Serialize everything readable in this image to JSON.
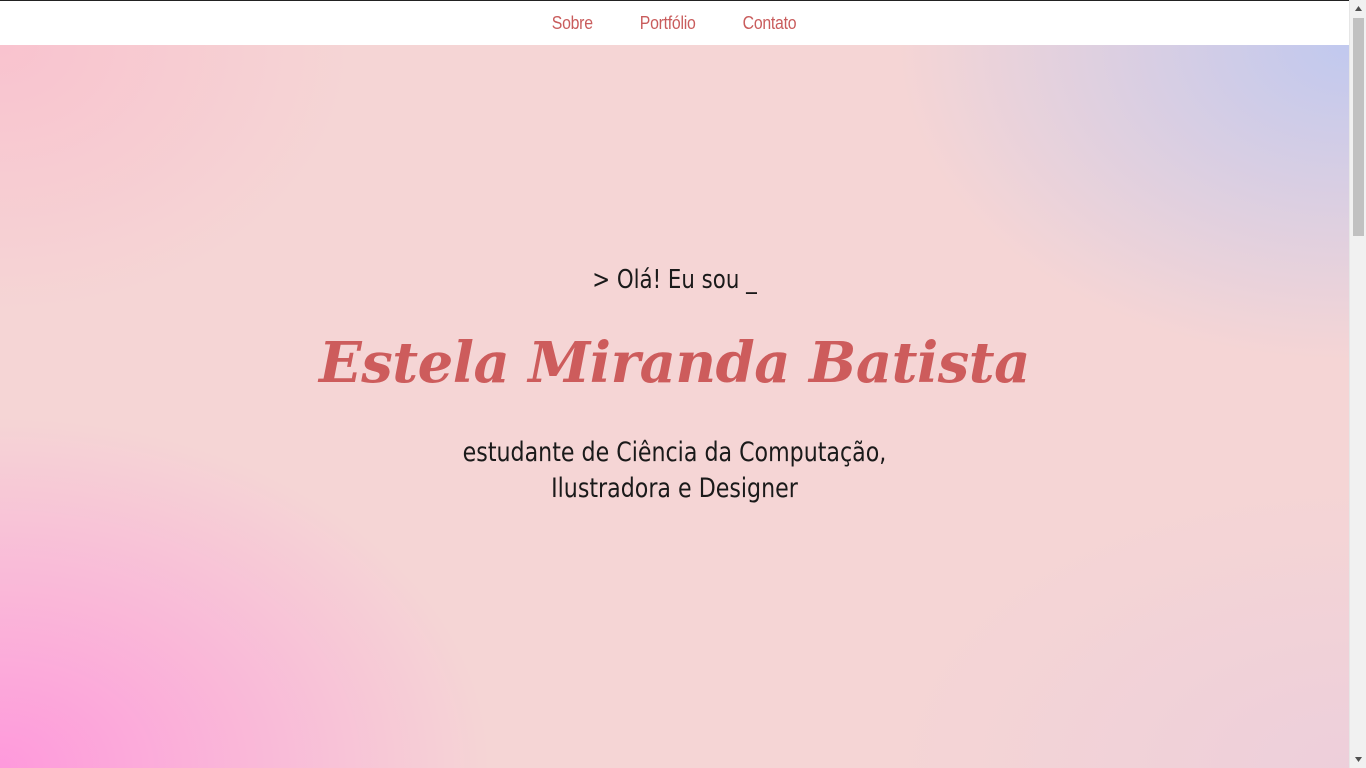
{
  "nav": {
    "items": [
      {
        "label": "Sobre"
      },
      {
        "label": "Portfólio"
      },
      {
        "label": "Contato"
      }
    ]
  },
  "hero": {
    "greeting": "> Olá! Eu sou _",
    "name": "Estela Miranda Batista",
    "subtitle_line1": "estudante de Ciência da Computação,",
    "subtitle_line2": "Ilustradora e Designer"
  },
  "colors": {
    "accent": "#cd5c5c",
    "nav_link": "#c95c5c",
    "text": "#1a1a1a",
    "gradient_pink": "#ff96dc",
    "gradient_blue": "#bec8f0",
    "gradient_base": "#f5d5d5"
  },
  "icons": {
    "scroll_up": "triangle-up-icon",
    "scroll_down": "triangle-down-icon"
  }
}
